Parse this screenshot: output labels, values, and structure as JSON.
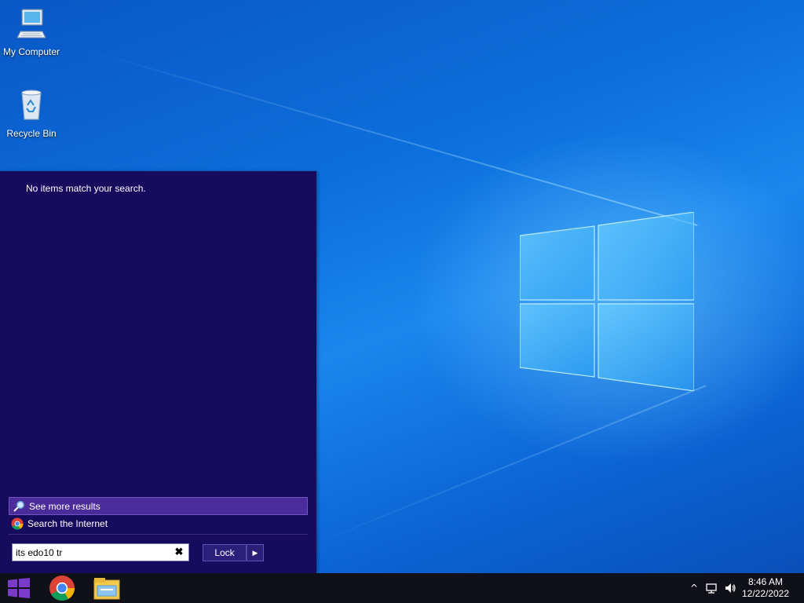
{
  "desktop": {
    "icons": [
      {
        "label": "My Computer",
        "icon": "computer-icon"
      },
      {
        "label": "Recycle Bin",
        "icon": "recycle-bin-icon"
      }
    ]
  },
  "start_menu": {
    "empty_message": "No items match your search.",
    "see_more_label": "See more results",
    "search_internet_label": "Search the Internet",
    "search_value": "its edo10 tr",
    "clear_glyph": "✖",
    "lock_label": "Lock",
    "lock_arrow_glyph": "▶"
  },
  "taskbar": {
    "apps": [
      "start-icon",
      "chrome-icon",
      "file-explorer-icon"
    ],
    "tray": {
      "chevron_glyph": "^",
      "time": "8:46 AM",
      "date": "12/22/2022"
    }
  },
  "colors": {
    "start_menu_bg": "#160b5c",
    "highlight": "#4a2c9a",
    "taskbar_bg": "#101018"
  }
}
